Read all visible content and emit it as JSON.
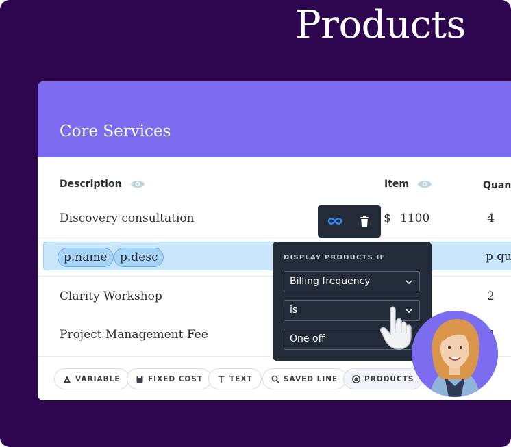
{
  "page": {
    "title": "Products"
  },
  "section": {
    "title": "Core Services"
  },
  "table": {
    "columns": {
      "description": "Description",
      "item": "Item",
      "quantity": "Quan"
    },
    "rows": [
      {
        "description": "Discovery consultation",
        "currency": "$",
        "price": "1100",
        "quantity": "4"
      },
      {
        "description": "Clarity Workshop",
        "quantity": "2"
      },
      {
        "description": "Project Management Fee",
        "quantity": "2"
      }
    ],
    "selected_row": {
      "chips": [
        "p.name",
        "p.desc"
      ],
      "quantity_value": "p.qu"
    }
  },
  "toolbar": {
    "link_icon": "infinity-icon",
    "delete_icon": "trash-icon"
  },
  "popover": {
    "title": "DISPLAY PRODUCTS IF",
    "field": "Billing frequency",
    "operator": "is",
    "value": "One off"
  },
  "footer": {
    "buttons": [
      {
        "label": "VARIABLE",
        "icon": "variable-icon"
      },
      {
        "label": "FIXED COST",
        "icon": "tag-icon"
      },
      {
        "label": "TEXT",
        "icon": "text-icon"
      },
      {
        "label": "SAVED LINE",
        "icon": "search-icon"
      },
      {
        "label": "PRODUCTS",
        "icon": "products-icon"
      }
    ]
  },
  "colors": {
    "background": "#2e0650",
    "accent": "#7b6cf0",
    "highlight": "#c9e6fb",
    "popover": "#232a38",
    "link": "#2f8ef5"
  }
}
